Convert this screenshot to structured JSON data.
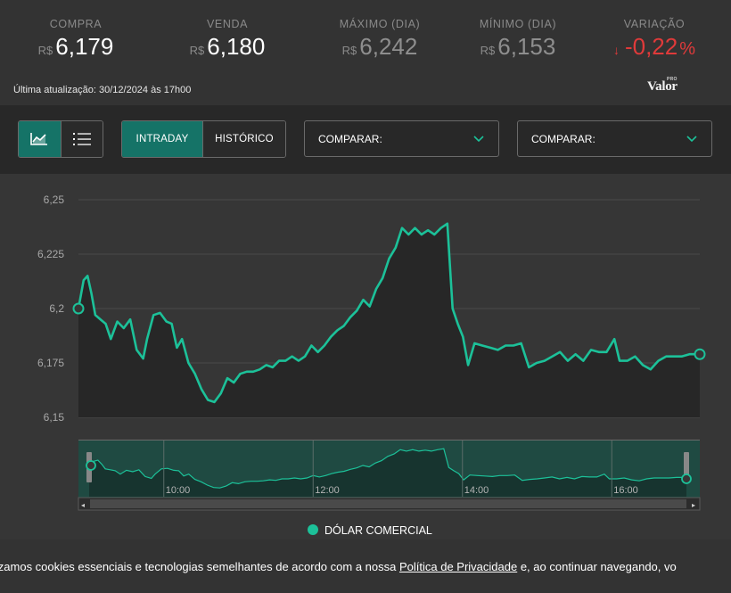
{
  "quotes": [
    {
      "label": "COMPRA",
      "currency": "R$",
      "value": "6,179"
    },
    {
      "label": "VENDA",
      "currency": "R$",
      "value": "6,180"
    },
    {
      "label": "MÁXIMO (DIA)",
      "currency": "R$",
      "value": "6,242"
    },
    {
      "label": "MÍNIMO (DIA)",
      "currency": "R$",
      "value": "6,153"
    },
    {
      "label": "VARIAÇÃO",
      "arrow": "↓",
      "value": "-0,22",
      "unit": "%"
    }
  ],
  "last_update": "Última atualização: 30/12/2024 às 17h00",
  "logo": {
    "text": "Valor",
    "badge": "PRO"
  },
  "toolbar": {
    "view_icons": [
      "line-chart-icon",
      "list-icon"
    ],
    "tabs": [
      "INTRADAY",
      "HISTÓRICO"
    ],
    "active_tab": "INTRADAY",
    "compare_1": "COMPARAR:",
    "compare_2": "COMPARAR:"
  },
  "colors": {
    "accent": "#157367",
    "line": "#1cc199",
    "negative": "#e03a3a",
    "area": "#272727"
  },
  "legend": {
    "label": "DÓLAR COMERCIAL"
  },
  "cookie": {
    "text_before": "lizamos cookies essenciais e tecnologias semelhantes de acordo com a nossa ",
    "link": "Política de Privacidade",
    "text_after": " e, ao continuar navegando, vo"
  },
  "chart_data": {
    "type": "line",
    "series": [
      {
        "name": "DÓLAR COMERCIAL"
      }
    ],
    "y_ticks": [
      "6,15",
      "6,175",
      "6,2",
      "6,225",
      "6,25"
    ],
    "ylim": [
      6.15,
      6.25
    ],
    "xlim": [
      "09:00",
      "17:00"
    ],
    "navigator_ticks": [
      "10:00",
      "12:00",
      "14:00",
      "16:00"
    ],
    "points": [
      [
        "09:00",
        6.2
      ],
      [
        "09:04",
        6.213
      ],
      [
        "09:07",
        6.215
      ],
      [
        "09:10",
        6.207
      ],
      [
        "09:13",
        6.197
      ],
      [
        "09:17",
        6.195
      ],
      [
        "09:21",
        6.193
      ],
      [
        "09:25",
        6.186
      ],
      [
        "09:30",
        6.194
      ],
      [
        "09:35",
        6.191
      ],
      [
        "09:40",
        6.195
      ],
      [
        "09:45",
        6.181
      ],
      [
        "09:50",
        6.177
      ],
      [
        "09:53",
        6.186
      ],
      [
        "09:58",
        6.197
      ],
      [
        "10:03",
        6.198
      ],
      [
        "10:08",
        6.194
      ],
      [
        "10:12",
        6.193
      ],
      [
        "10:16",
        6.182
      ],
      [
        "10:20",
        6.186
      ],
      [
        "10:25",
        6.175
      ],
      [
        "10:30",
        6.17
      ],
      [
        "10:35",
        6.163
      ],
      [
        "10:40",
        6.158
      ],
      [
        "10:45",
        6.157
      ],
      [
        "10:50",
        6.161
      ],
      [
        "10:55",
        6.168
      ],
      [
        "11:00",
        6.166
      ],
      [
        "11:05",
        6.17
      ],
      [
        "11:10",
        6.171
      ],
      [
        "11:15",
        6.171
      ],
      [
        "11:20",
        6.172
      ],
      [
        "11:25",
        6.174
      ],
      [
        "11:30",
        6.173
      ],
      [
        "11:35",
        6.176
      ],
      [
        "11:40",
        6.176
      ],
      [
        "11:45",
        6.178
      ],
      [
        "11:50",
        6.176
      ],
      [
        "11:55",
        6.178
      ],
      [
        "12:00",
        6.183
      ],
      [
        "12:05",
        6.18
      ],
      [
        "12:10",
        6.183
      ],
      [
        "12:15",
        6.187
      ],
      [
        "12:20",
        6.19
      ],
      [
        "12:25",
        6.192
      ],
      [
        "12:30",
        6.196
      ],
      [
        "12:35",
        6.199
      ],
      [
        "12:40",
        6.204
      ],
      [
        "12:45",
        6.201
      ],
      [
        "12:50",
        6.209
      ],
      [
        "12:55",
        6.214
      ],
      [
        "13:00",
        6.223
      ],
      [
        "13:05",
        6.228
      ],
      [
        "13:10",
        6.237
      ],
      [
        "13:15",
        6.234
      ],
      [
        "13:20",
        6.237
      ],
      [
        "13:25",
        6.234
      ],
      [
        "13:30",
        6.236
      ],
      [
        "13:35",
        6.234
      ],
      [
        "13:40",
        6.237
      ],
      [
        "13:45",
        6.239
      ],
      [
        "13:49",
        6.2
      ],
      [
        "13:53",
        6.193
      ],
      [
        "13:57",
        6.187
      ],
      [
        "14:01",
        6.174
      ],
      [
        "14:06",
        6.184
      ],
      [
        "14:12",
        6.183
      ],
      [
        "14:18",
        6.182
      ],
      [
        "14:24",
        6.181
      ],
      [
        "14:30",
        6.183
      ],
      [
        "14:36",
        6.183
      ],
      [
        "14:42",
        6.184
      ],
      [
        "14:48",
        6.173
      ],
      [
        "14:54",
        6.175
      ],
      [
        "15:00",
        6.176
      ],
      [
        "15:06",
        6.178
      ],
      [
        "15:12",
        6.18
      ],
      [
        "15:18",
        6.176
      ],
      [
        "15:24",
        6.179
      ],
      [
        "15:30",
        6.176
      ],
      [
        "15:36",
        6.181
      ],
      [
        "15:42",
        6.18
      ],
      [
        "15:48",
        6.18
      ],
      [
        "15:54",
        6.186
      ],
      [
        "15:58",
        6.176
      ],
      [
        "16:04",
        6.176
      ],
      [
        "16:10",
        6.178
      ],
      [
        "16:16",
        6.174
      ],
      [
        "16:22",
        6.172
      ],
      [
        "16:28",
        6.176
      ],
      [
        "16:34",
        6.178
      ],
      [
        "16:40",
        6.178
      ],
      [
        "16:46",
        6.178
      ],
      [
        "16:52",
        6.179
      ],
      [
        "17:00",
        6.179
      ]
    ],
    "grid": true,
    "legend_position": "bottom-center"
  }
}
